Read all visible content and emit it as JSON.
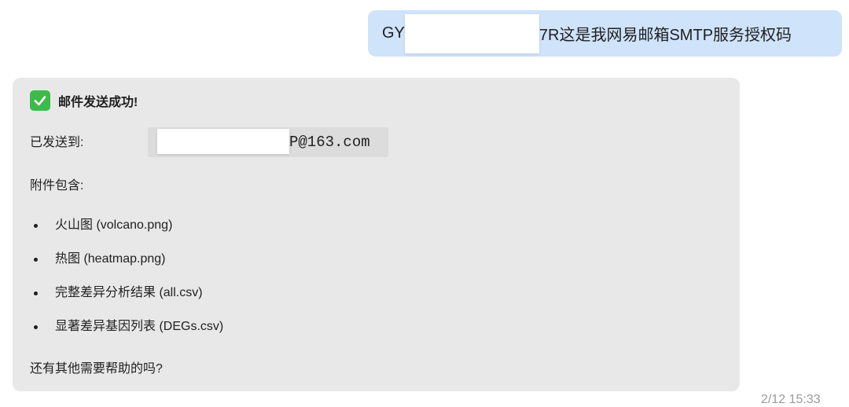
{
  "user_message": {
    "prefix": "GY",
    "suffix": "7R这是我网易邮箱SMTP服务授权码"
  },
  "bot_message": {
    "success_text": "邮件发送成功!",
    "sent_to_label": "已发送到:",
    "email_suffix": "P@163.com",
    "attachments_label": "附件包含:",
    "attachments": [
      "火山图 (volcano.png)",
      "热图 (heatmap.png)",
      "完整差异分析结果 (all.csv)",
      "显著差异基因列表 (DEGs.csv)"
    ],
    "closing": "还有其他需要帮助的吗?"
  },
  "timestamp": "2/12 15:33",
  "colors": {
    "user_bubble": "#cfe3fb",
    "bot_bubble": "#e8e8e8",
    "check_green": "#3dbb4a"
  },
  "icons": [
    "check-mark-icon"
  ]
}
